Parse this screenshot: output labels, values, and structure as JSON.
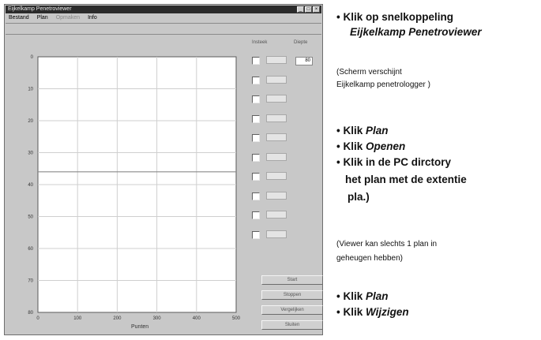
{
  "window": {
    "title": "Eijkelkamp Penetroviewer",
    "menu": [
      "Bestand",
      "Plan",
      "Opmaken",
      "Info"
    ],
    "menu_disabled": [
      false,
      false,
      true,
      false
    ]
  },
  "chart": {
    "ylabel": "",
    "xlabel": "Punten",
    "y_ticks": [
      "0",
      "10",
      "20",
      "30",
      "40",
      "50",
      "60",
      "70",
      "80"
    ],
    "x_ticks": [
      "0",
      "100",
      "200",
      "300",
      "400",
      "500"
    ]
  },
  "chart_data": {
    "type": "line",
    "x": [
      0,
      100,
      200,
      300,
      400,
      500
    ],
    "y_ticks": [
      0,
      10,
      20,
      30,
      40,
      50,
      60,
      70,
      80
    ],
    "ylim": [
      0,
      80
    ],
    "xlim": [
      0,
      500
    ],
    "reference_line_y": 36,
    "grid": true,
    "xlabel": "Punten",
    "ylabel": ""
  },
  "panel": {
    "col1": "Insteek",
    "col2": "Diepte",
    "depth_value": "80",
    "buttons": [
      "Start",
      "Stoppen",
      "Vergelijken",
      "Sluiten"
    ]
  },
  "instructions": {
    "step1_line1": "• Klik op snelkoppeling",
    "step1_line2": "Eijkelkamp Penetroviewer",
    "note1_line1": "(Scherm verschijnt",
    "note1_line2": "Eijkelkamp penetrologger )",
    "b1_prefix": "• Klik ",
    "b1_word": "Plan",
    "b2_prefix": "• Klik ",
    "b2_word": "Openen",
    "b3_line1": "• Klik in de PC dirctory",
    "b3_line2": "het plan met de extentie",
    "b3_line3": "pla.)",
    "note2_line1": "(Viewer kan slechts 1 plan in",
    "note2_line2": "geheugen hebben)",
    "b4_prefix": "• Klik ",
    "b4_word": "Plan",
    "b5_prefix": "• Klik ",
    "b5_word": "Wijzigen"
  }
}
